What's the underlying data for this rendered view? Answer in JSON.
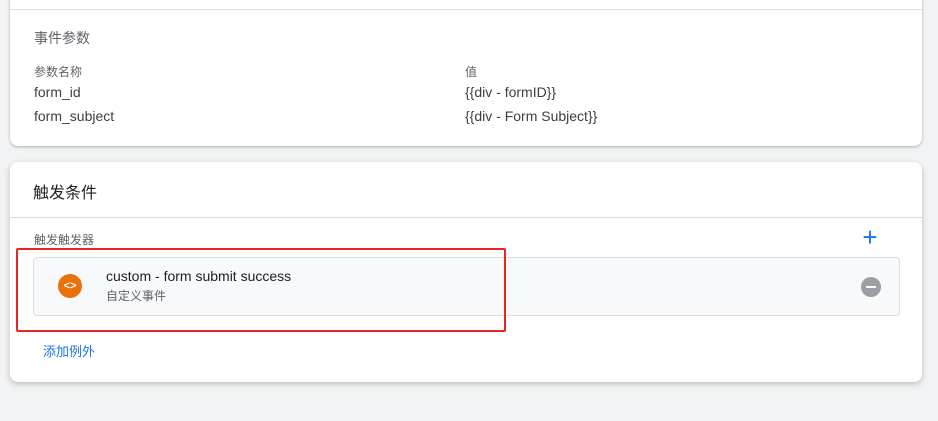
{
  "event_params": {
    "section_label": "事件参数",
    "col_name_header": "参数名称",
    "col_value_header": "值",
    "rows": [
      {
        "name": "form_id",
        "value": "{{div - formID}}"
      },
      {
        "name": "form_subject",
        "value": "{{div - Form Subject}}"
      }
    ]
  },
  "triggering": {
    "title": "触发条件",
    "sub_label": "触发触发器",
    "add_icon": "plus-icon",
    "trigger": {
      "icon": "code-icon",
      "icon_glyph": "<>",
      "icon_color": "#e8710a",
      "name": "custom - form submit success",
      "type": "自定义事件"
    },
    "remove_icon": "remove-circle-icon",
    "add_exception_label": "添加例外"
  },
  "colors": {
    "accent": "#1a73e8",
    "highlight": "#e8251f"
  }
}
